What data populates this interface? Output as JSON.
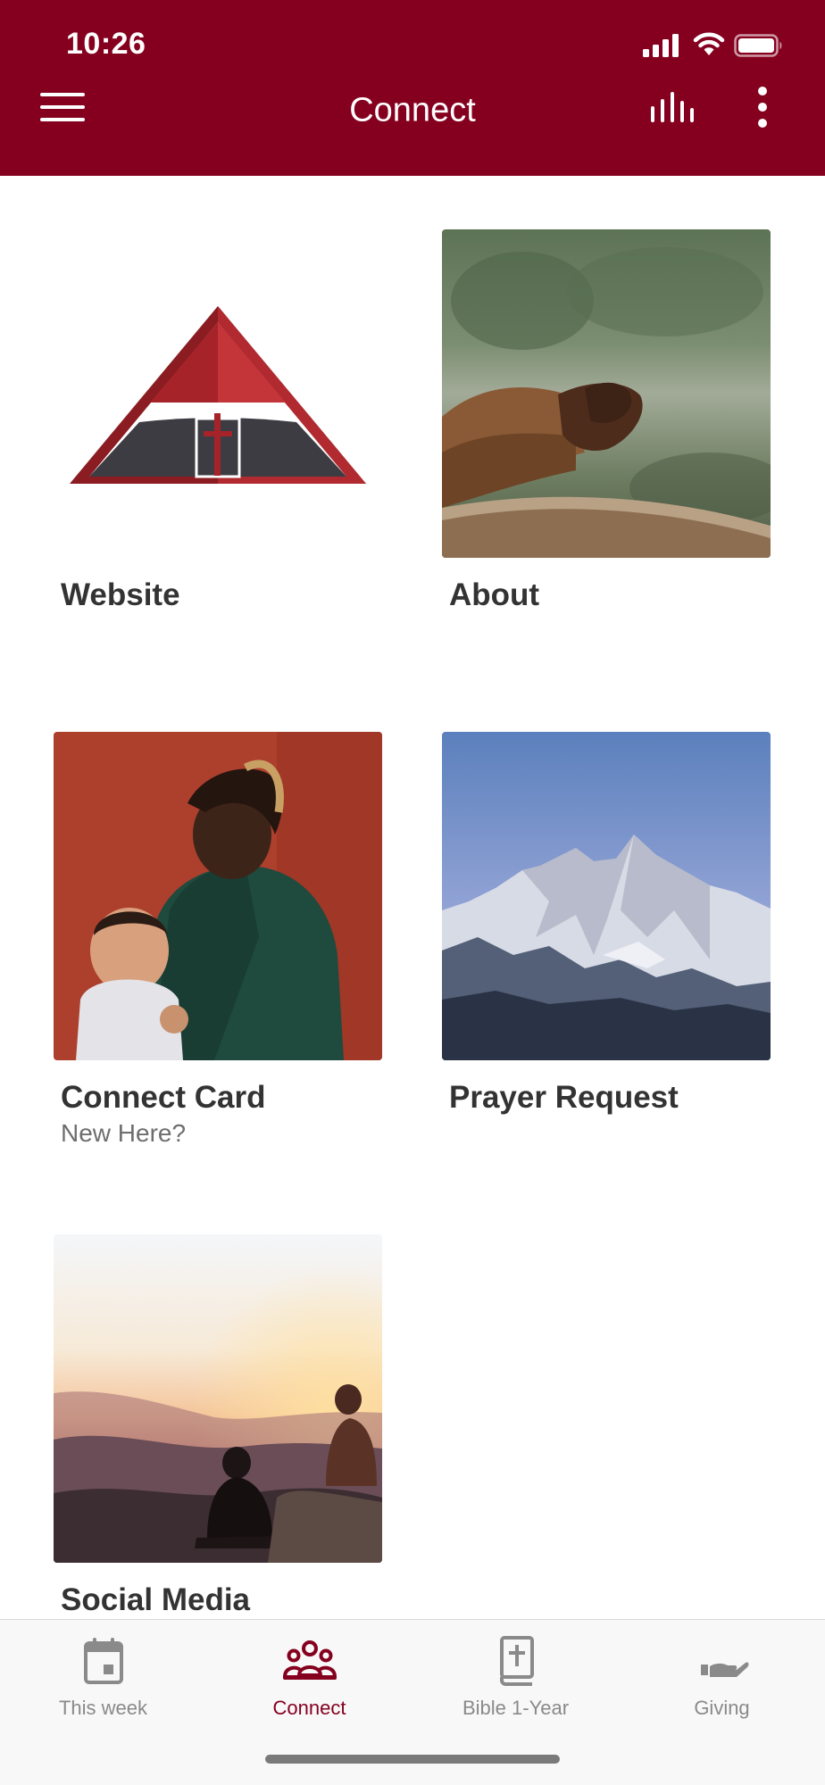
{
  "status_bar": {
    "time": "10:26"
  },
  "appbar": {
    "title": "Connect",
    "menu_icon": "hamburger-menu-icon",
    "audio_icon": "audio-levels-icon",
    "more_icon": "more-vertical-icon"
  },
  "tiles": [
    {
      "title": "Website",
      "subtitle": ""
    },
    {
      "title": "About",
      "subtitle": ""
    },
    {
      "title": "Connect Card",
      "subtitle": "New Here?"
    },
    {
      "title": "Prayer Request",
      "subtitle": ""
    },
    {
      "title": "Social Media",
      "subtitle": ""
    }
  ],
  "bottom_nav": {
    "items": [
      {
        "label": "This week",
        "icon": "calendar-icon"
      },
      {
        "label": "Connect",
        "icon": "people-group-icon"
      },
      {
        "label": "Bible 1-Year",
        "icon": "bible-icon"
      },
      {
        "label": "Giving",
        "icon": "giving-hand-icon"
      }
    ],
    "active_index": 1
  },
  "colors": {
    "brand": "#85001f",
    "text": "#333333",
    "muted": "#8a8a8a"
  }
}
